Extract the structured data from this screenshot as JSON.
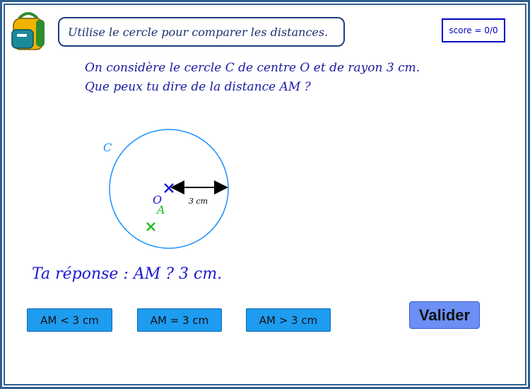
{
  "header": {
    "instruction": "Utilise le cercle pour comparer les distances.",
    "score": "score = 0/0"
  },
  "question": {
    "line1": "On considère le cercle C de centre O et de rayon 3 cm.",
    "line2": "Que peux tu dire de la distance AM ?"
  },
  "figure": {
    "circle_label": "C",
    "center_label": "O",
    "point_label": "A",
    "radius_label": "3 cm",
    "colors": {
      "circle": "#1e90ff",
      "center_mark": "#1a1ad0",
      "point_mark": "#1fbf1f",
      "arrow": "#000000"
    }
  },
  "answer": {
    "text": "Ta réponse : AM ? 3 cm."
  },
  "choices": {
    "less": "AM < 3 cm",
    "equal": "AM = 3 cm",
    "greater": "AM > 3 cm"
  },
  "validate_label": "Valider",
  "icons": {
    "logo": "backpack-icon"
  }
}
